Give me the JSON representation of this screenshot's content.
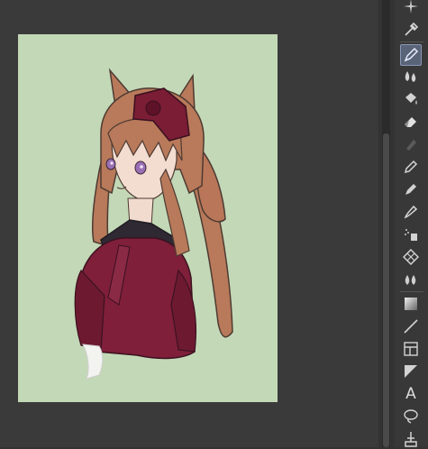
{
  "app": {
    "canvas_background": "#c3d8b6",
    "workspace_background": "#3a3a3a",
    "accent": "#5a6478"
  },
  "canvas": {
    "subject": "anime-girl-sketch"
  },
  "toolbar": {
    "tools": [
      {
        "name": "sparkle-tool-icon",
        "active": false
      },
      {
        "name": "eyedropper-tool-icon",
        "active": false
      },
      {
        "name": "pen-tool-icon",
        "active": true
      },
      {
        "name": "blend-drops-tool-icon",
        "active": false
      },
      {
        "name": "fill-bucket-tool-icon",
        "active": false
      },
      {
        "name": "eraser-tool-icon",
        "active": false
      },
      {
        "name": "smudge-tool-icon",
        "active": false
      },
      {
        "name": "pencil-tool-icon",
        "active": false
      },
      {
        "name": "marker-tool-icon",
        "active": false
      },
      {
        "name": "ink-pen-tool-icon",
        "active": false
      },
      {
        "name": "airbrush-tool-icon",
        "active": false
      },
      {
        "name": "pattern-tool-icon",
        "active": false
      },
      {
        "name": "watercolor-tool-icon",
        "active": false
      },
      {
        "name": "gradient-tool-icon",
        "active": false
      },
      {
        "name": "line-tool-icon",
        "active": false
      },
      {
        "name": "frame-tool-icon",
        "active": false
      },
      {
        "name": "ruler-tool-icon",
        "active": false
      },
      {
        "name": "text-tool-icon",
        "active": false,
        "glyph": "A"
      },
      {
        "name": "lasso-tool-icon",
        "active": false
      },
      {
        "name": "move-tool-icon",
        "active": false
      }
    ]
  }
}
